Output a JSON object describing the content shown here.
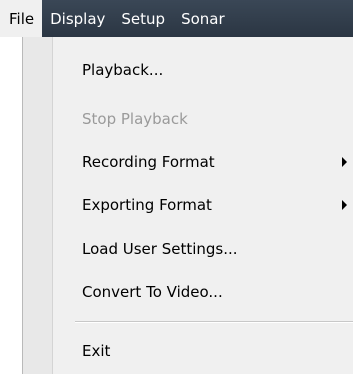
{
  "menubar": {
    "items": [
      {
        "label": "File",
        "active": true
      },
      {
        "label": "Display"
      },
      {
        "label": "Setup"
      },
      {
        "label": "Sonar"
      }
    ]
  },
  "file_menu": {
    "items": [
      {
        "label": "Playback...",
        "enabled": true
      },
      {
        "label": "Stop Playback",
        "enabled": false
      },
      {
        "label": "Recording Format",
        "enabled": true,
        "submenu": true
      },
      {
        "label": "Exporting Format",
        "enabled": true,
        "submenu": true
      },
      {
        "label": "Load User Settings...",
        "enabled": true
      },
      {
        "label": "Convert To Video...",
        "enabled": true
      },
      {
        "label": "Exit",
        "enabled": true
      }
    ]
  },
  "colors": {
    "menubar_bg": "#2f3a47",
    "menu_bg": "#f0f0f0",
    "disabled_text": "#9a9a9a"
  }
}
